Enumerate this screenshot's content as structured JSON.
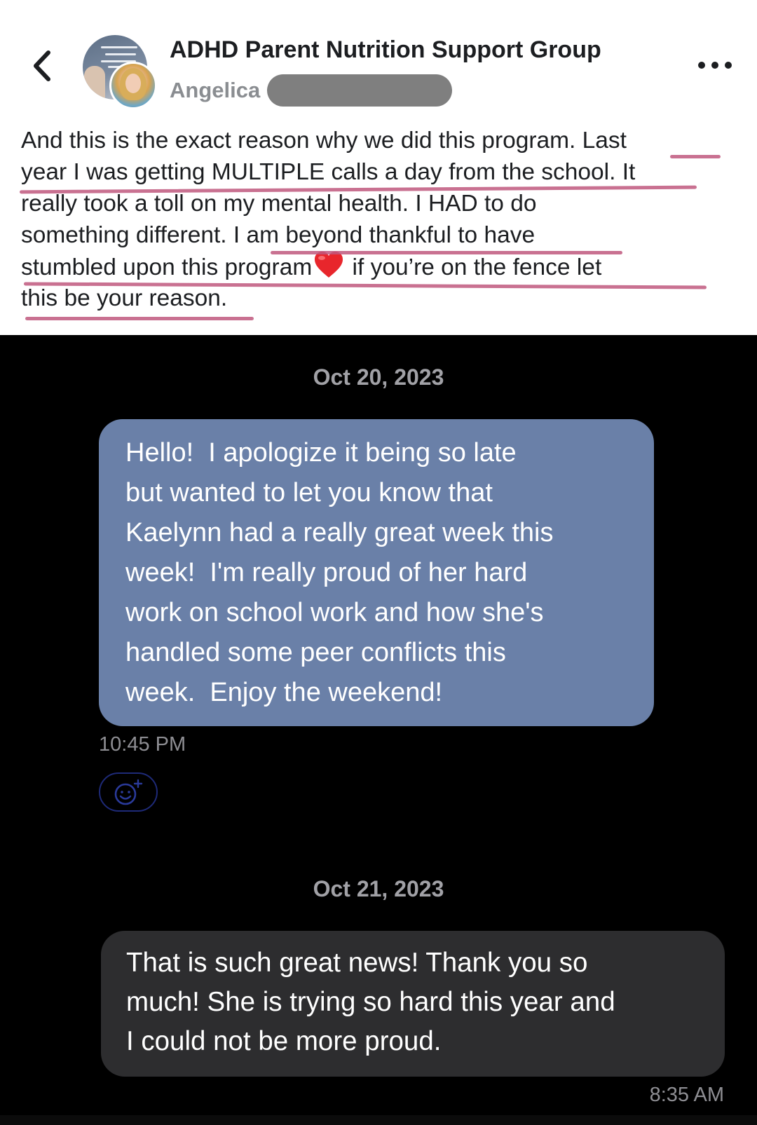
{
  "post": {
    "group_title": "ADHD Parent Nutrition Support Group",
    "author": "Angelica",
    "lines": [
      "And this is the exact reason why we did this program. Last",
      "year I was getting MULTIPLE calls a day from the school. It",
      "really took a toll on my mental health. I HAD to do",
      "something different. I am beyond thankful to have",
      "stumbled upon this program",
      " if you’re on the fence let",
      "this be your reason."
    ],
    "emoji": "red-heart",
    "underline_color": "#c0587e"
  },
  "chat": {
    "date_1": "Oct 20, 2023",
    "incoming": {
      "lines": [
        "Hello!  I apologize it being so late",
        "but wanted to let you know that",
        "Kaelynn had a really great week this",
        "week!  I'm really proud of her hard",
        "work on school work and how she's",
        "handled some peer conflicts this",
        "week.  Enjoy the weekend!"
      ],
      "time": "10:45 PM",
      "bubble_color": "#6a80a8"
    },
    "date_2": "Oct 21, 2023",
    "outgoing": {
      "lines": [
        "That is such great news! Thank you so",
        "much! She is trying so hard this year and",
        "I could not be more proud."
      ],
      "time": "8:35 AM",
      "bubble_color": "#2d2d2f"
    }
  },
  "icons": {
    "back": "chevron-left-icon",
    "more": "more-horizontal-icon",
    "react": "add-reaction-icon"
  }
}
